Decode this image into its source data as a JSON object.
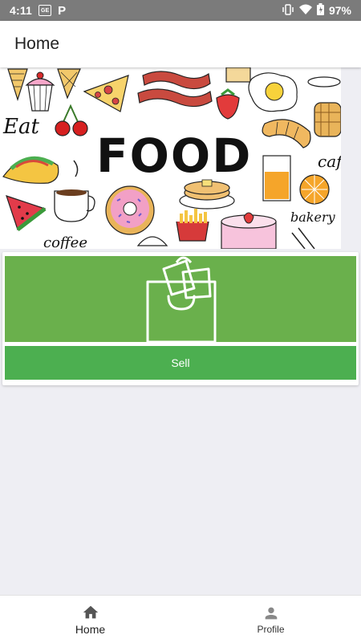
{
  "status_bar": {
    "time": "4:11",
    "notif_badge": "GE",
    "p_icon_label": "P",
    "battery": "97%"
  },
  "app_bar": {
    "title": "Home"
  },
  "hero": {
    "headline": "FOOD",
    "doodle_words": [
      "Eat",
      "coffee",
      "bakery",
      "caf"
    ]
  },
  "sell_card": {
    "button_label": "Sell"
  },
  "bottom_nav": {
    "items": [
      {
        "label": "Home",
        "icon": "home-icon",
        "active": true
      },
      {
        "label": "Profile",
        "icon": "person-icon",
        "active": false
      }
    ]
  },
  "colors": {
    "status_bar": "#7b7b7b",
    "card_green": "#6ab04c",
    "button_green": "#4caf50",
    "background": "#eeeef3"
  }
}
